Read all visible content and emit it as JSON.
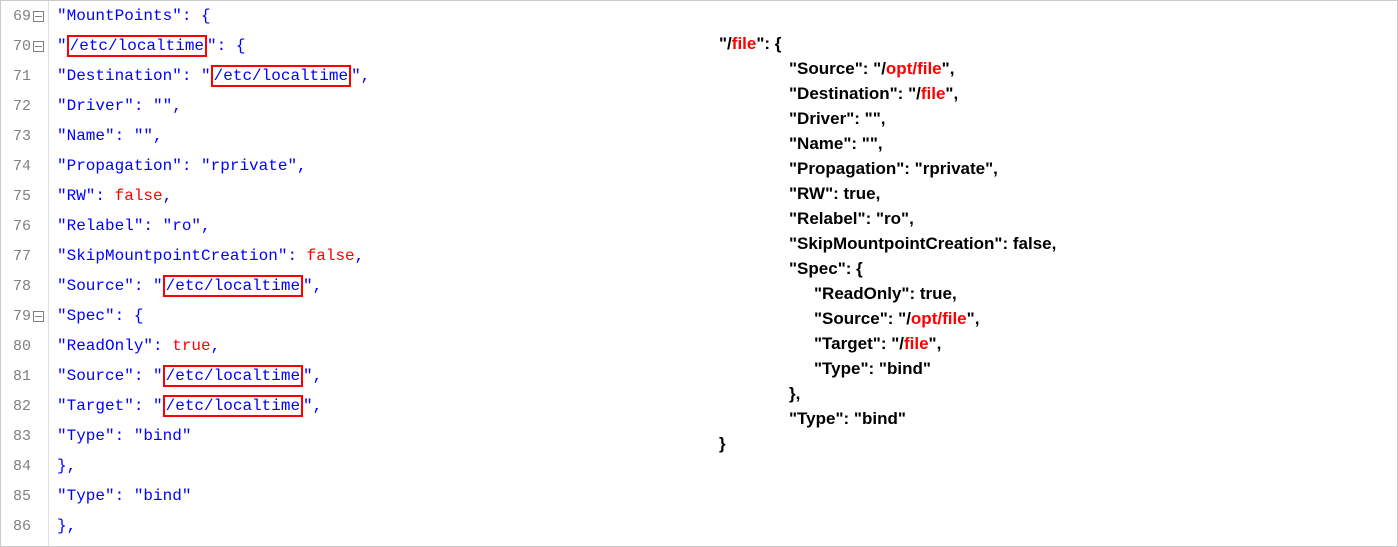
{
  "gutter": {
    "lines": [
      69,
      70,
      71,
      72,
      73,
      74,
      75,
      76,
      77,
      78,
      79,
      80,
      81,
      82,
      83,
      84,
      85,
      86
    ],
    "foldable": [
      69,
      70,
      79
    ]
  },
  "left": {
    "l69_key": "\"MountPoints\"",
    "l69_brace": ": {",
    "l70_q1": "\"",
    "l70_key": "/etc/localtime",
    "l70_q2": "\"",
    "l70_brace": ": {",
    "l71_key": "\"Destination\"",
    "l71_sep": ": \"",
    "l71_val": "/etc/localtime",
    "l71_end": "\",",
    "l72_key": "\"Driver\"",
    "l72_rest": ": \"\",",
    "l73_key": "\"Name\"",
    "l73_rest": ": \"\",",
    "l74_key": "\"Propagation\"",
    "l74_rest": ": \"rprivate\",",
    "l75_key": "\"RW\"",
    "l75_sep": ": ",
    "l75_val": "false",
    "l75_end": ",",
    "l76_key": "\"Relabel\"",
    "l76_rest": ": \"ro\",",
    "l77_key": "\"SkipMountpointCreation\"",
    "l77_sep": ": ",
    "l77_val": "false",
    "l77_end": ",",
    "l78_key": "\"Source\"",
    "l78_sep": ": \"",
    "l78_val": "/etc/localtime",
    "l78_end": "\",",
    "l79_key": "\"Spec\"",
    "l79_brace": ": {",
    "l80_key": "\"ReadOnly\"",
    "l80_sep": ": ",
    "l80_val": "true",
    "l80_end": ",",
    "l81_key": "\"Source\"",
    "l81_sep": ": \"",
    "l81_val": "/etc/localtime",
    "l81_end": "\",",
    "l82_key": "\"Target\"",
    "l82_sep": ": \"",
    "l82_val": "/etc/localtime",
    "l82_end": "\",",
    "l83_key": "\"Type\"",
    "l83_rest": ": \"bind\"",
    "l84": "},",
    "l85_key": "\"Type\"",
    "l85_rest": ": \"bind\"",
    "l86": "},"
  },
  "right": {
    "l1_a": "\"/",
    "l1_b": "file",
    "l1_c": "\": {",
    "l2_a": "\"Source\": \"/",
    "l2_b": "opt/file",
    "l2_c": "\",",
    "l3_a": "\"Destination\": \"/",
    "l3_b": "file",
    "l3_c": "\",",
    "l4": "\"Driver\": \"\",",
    "l5": "\"Name\": \"\",",
    "l6": "\"Propagation\": \"rprivate\",",
    "l7": "\"RW\": true,",
    "l8": "\"Relabel\": \"ro\",",
    "l9": "\"SkipMountpointCreation\": false,",
    "l10": "\"Spec\": {",
    "l11": "\"ReadOnly\": true,",
    "l12_a": "\"Source\": \"/",
    "l12_b": "opt/file",
    "l12_c": "\",",
    "l13_a": "\"Target\": \"/",
    "l13_b": "file",
    "l13_c": "\",",
    "l14": "\"Type\": \"bind\"",
    "l15": "},",
    "l16": "\"Type\": \"bind\"",
    "l17": "}"
  }
}
